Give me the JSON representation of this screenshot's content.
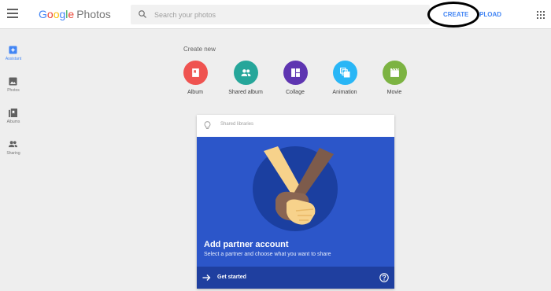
{
  "header": {
    "logo_google": [
      "G",
      "o",
      "o",
      "g",
      "l",
      "e"
    ],
    "logo_photos": "Photos",
    "search_placeholder": "Search your photos",
    "create_label": "CREATE",
    "upload_label": "PLOAD"
  },
  "sidebar": {
    "items": [
      {
        "label": "Assistant",
        "icon": "assistant-icon",
        "active": true
      },
      {
        "label": "Photos",
        "icon": "photos-icon"
      },
      {
        "label": "Albums",
        "icon": "albums-icon"
      },
      {
        "label": "Sharing",
        "icon": "sharing-icon"
      }
    ]
  },
  "create_new": {
    "heading": "Create new",
    "items": [
      {
        "label": "Album",
        "icon": "album-icon",
        "color": "#ef5350"
      },
      {
        "label": "Shared album",
        "icon": "shared-album-icon",
        "color": "#26a69a"
      },
      {
        "label": "Collage",
        "icon": "collage-icon",
        "color": "#5e35b1"
      },
      {
        "label": "Animation",
        "icon": "animation-icon",
        "color": "#29b6f6"
      },
      {
        "label": "Movie",
        "icon": "movie-icon",
        "color": "#7cb342"
      }
    ]
  },
  "card": {
    "header_label": "Shared libraries",
    "title": "Add partner account",
    "subtitle": "Select a partner and choose what you want to share",
    "action_label": "Get started",
    "colors": {
      "banner": "#2c56c9",
      "footer": "#1f3f9f"
    }
  }
}
